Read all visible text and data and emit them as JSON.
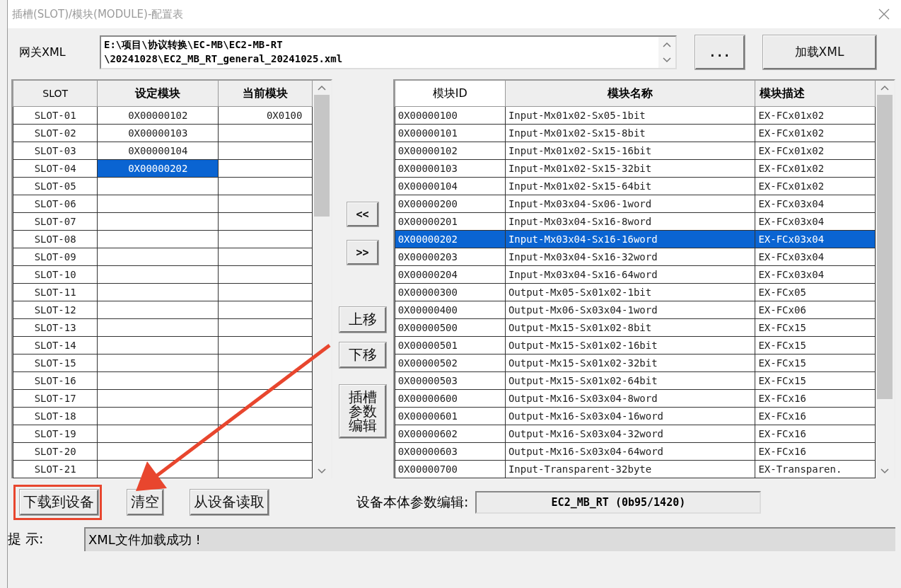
{
  "window": {
    "title": "插槽(SLOT)/模块(MODULE)-配置表"
  },
  "gateway": {
    "label": "网关XML",
    "path_lines": [
      "E:\\项目\\协议转换\\EC-MB\\EC2-MB-RT",
      "\\20241028\\EC2_MB_RT_general_20241025.xml"
    ],
    "browse_button": "...",
    "load_button": "加载XML"
  },
  "slot_table": {
    "columns": [
      "SLOT",
      "设定模块",
      "当前模块"
    ],
    "rows": [
      {
        "slot": "SLOT-01",
        "set_module": "0X00000102",
        "current_module": "0X0100",
        "selected": false
      },
      {
        "slot": "SLOT-02",
        "set_module": "0X00000103",
        "selected": false
      },
      {
        "slot": "SLOT-03",
        "set_module": "0X00000104",
        "selected": false
      },
      {
        "slot": "SLOT-04",
        "set_module": "0X00000202",
        "selected": true
      },
      {
        "slot": "SLOT-05",
        "selected": false
      },
      {
        "slot": "SLOT-06",
        "selected": false
      },
      {
        "slot": "SLOT-07",
        "selected": false
      },
      {
        "slot": "SLOT-08",
        "selected": false
      },
      {
        "slot": "SLOT-09",
        "selected": false
      },
      {
        "slot": "SLOT-10",
        "selected": false
      },
      {
        "slot": "SLOT-11",
        "selected": false
      },
      {
        "slot": "SLOT-12",
        "selected": false
      },
      {
        "slot": "SLOT-13",
        "selected": false
      },
      {
        "slot": "SLOT-14",
        "selected": false
      },
      {
        "slot": "SLOT-15",
        "selected": false
      },
      {
        "slot": "SLOT-16",
        "selected": false
      },
      {
        "slot": "SLOT-17",
        "selected": false
      },
      {
        "slot": "SLOT-18",
        "selected": false
      },
      {
        "slot": "SLOT-19",
        "selected": false
      },
      {
        "slot": "SLOT-20",
        "selected": false
      },
      {
        "slot": "SLOT-21",
        "selected": false
      }
    ]
  },
  "middle_buttons": [
    "<<",
    ">>",
    "上移",
    "下移",
    "插槽参数编辑"
  ],
  "module_table": {
    "columns": [
      "模块ID",
      "模块名称",
      "模块描述"
    ],
    "rows": [
      {
        "id": "0X00000100",
        "name": "Input-Mx01x02-Sx05-1bit",
        "desc": "EX-FCx01x02",
        "selected": false
      },
      {
        "id": "0X00000101",
        "name": "Input-Mx01x02-Sx15-8bit",
        "desc": "EX-FCx01x02",
        "selected": false
      },
      {
        "id": "0X00000102",
        "name": "Input-Mx01x02-Sx15-16bit",
        "desc": "EX-FCx01x02",
        "selected": false
      },
      {
        "id": "0X00000103",
        "name": "Input-Mx01x02-Sx15-32bit",
        "desc": "EX-FCx01x02",
        "selected": false
      },
      {
        "id": "0X00000104",
        "name": "Input-Mx01x02-Sx15-64bit",
        "desc": "EX-FCx01x02",
        "selected": false
      },
      {
        "id": "0X00000200",
        "name": "Input-Mx03x04-Sx06-1word",
        "desc": "EX-FCx03x04",
        "selected": false
      },
      {
        "id": "0X00000201",
        "name": "Input-Mx03x04-Sx16-8word",
        "desc": "EX-FCx03x04",
        "selected": false
      },
      {
        "id": "0X00000202",
        "name": "Input-Mx03x04-Sx16-16word",
        "desc": "EX-FCx03x04",
        "selected": true
      },
      {
        "id": "0X00000203",
        "name": "Input-Mx03x04-Sx16-32word",
        "desc": "EX-FCx03x04",
        "selected": false
      },
      {
        "id": "0X00000204",
        "name": "Input-Mx03x04-Sx16-64word",
        "desc": "EX-FCx03x04",
        "selected": false
      },
      {
        "id": "0X00000300",
        "name": "Output-Mx05-Sx01x02-1bit",
        "desc": "EX-FCx05",
        "selected": false
      },
      {
        "id": "0X00000400",
        "name": "Output-Mx06-Sx03x04-1word",
        "desc": "EX-FCx06",
        "selected": false
      },
      {
        "id": "0X00000500",
        "name": "Output-Mx15-Sx01x02-8bit",
        "desc": "EX-FCx15",
        "selected": false
      },
      {
        "id": "0X00000501",
        "name": "Output-Mx15-Sx01x02-16bit",
        "desc": "EX-FCx15",
        "selected": false
      },
      {
        "id": "0X00000502",
        "name": "Output-Mx15-Sx01x02-32bit",
        "desc": "EX-FCx15",
        "selected": false
      },
      {
        "id": "0X00000503",
        "name": "Output-Mx15-Sx01x02-64bit",
        "desc": "EX-FCx15",
        "selected": false
      },
      {
        "id": "0X00000600",
        "name": "Output-Mx16-Sx03x04-8word",
        "desc": "EX-FCx16",
        "selected": false
      },
      {
        "id": "0X00000601",
        "name": "Output-Mx16-Sx03x04-16word",
        "desc": "EX-FCx16",
        "selected": false
      },
      {
        "id": "0X00000602",
        "name": "Output-Mx16-Sx03x04-32word",
        "desc": "EX-FCx16",
        "selected": false
      },
      {
        "id": "0X00000603",
        "name": "Output-Mx16-Sx03x04-64word",
        "desc": "EX-FCx16",
        "selected": false
      },
      {
        "id": "0X00000700",
        "name": "Input-Transparent-32byte",
        "desc": "EX-Transparen.",
        "selected": false
      }
    ]
  },
  "bottom_buttons": [
    {
      "label": "下载到设备",
      "highlighted": true
    },
    {
      "label": "清空",
      "highlighted": false
    },
    {
      "label": "从设备读取",
      "highlighted": false
    }
  ],
  "device": {
    "label": "设备本体参数编辑:",
    "value": "EC2_MB_RT (0b95/1420)"
  },
  "hint": {
    "label": "提 示:",
    "message": "XML文件加载成功 !"
  }
}
